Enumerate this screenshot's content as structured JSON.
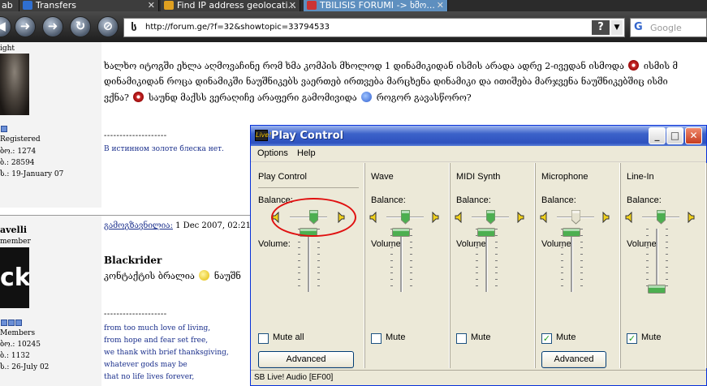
{
  "browser": {
    "tabs": [
      {
        "label": "ab",
        "active": false
      },
      {
        "label": "Transfers",
        "active": false
      },
      {
        "label": "Find IP address geolocati...",
        "active": false
      },
      {
        "label": "TBILISIS FORUMI -> ხმო...",
        "active": true
      }
    ],
    "url": "http://forum.ge/?f=32&showtopic=33794533",
    "help_glyph": "?",
    "search_placeholder": "Google",
    "search_logo": "G",
    "close_glyph": "✕",
    "site_favicon": "ს"
  },
  "forum": {
    "user1": {
      "name_partial": "ight",
      "group": "Registered",
      "posts_label": "ბო.: 1274",
      "id_label": "ბ.: 28594",
      "joined": "ს.: 19-January 07"
    },
    "user2": {
      "name_partial": "avelli",
      "rank": "member",
      "avatar_text": "ck",
      "group": "Members",
      "posts_label": "ბო.: 10245",
      "id_label": "ბ.: 1132",
      "joined": "ს.: 26-July 02"
    },
    "post1": {
      "line1": "ხალხო იტოგში ეხლა აღმოვაჩინე რომ ხმა კომპის მხოლოდ 1 დინამიკიდან ისმის არადა ადრე 2-ივედან ისმოდა",
      "line1_tail": "ისმის მ",
      "line2": "დინამიკიდან როცა დინამიკში ნაუშნიკებს ვაერთებ ირთვება მარცხენა დინამიკი და ითიშება მარჯვენა ნაუშნიკებშიც ისმი",
      "line3_a": "ვქნა?",
      "line3_b": "საუნდ მაქსს ვერაღიჩე არაფერი გამომივიდა",
      "line3_c": "როგორ გავასწორო?",
      "dashes": "--------------------",
      "signature": "В истинном золоте блеска нет."
    },
    "post2": {
      "author_link": "გამოგზავნილია:",
      "date": "1 Dec 2007, 02:21",
      "author": "Blackrider",
      "text": "კონტაქტის ბრალია",
      "text_tail": "ნაუშნ",
      "dashes": "--------------------",
      "sig_lines": [
        "from too much love of living,",
        "from hope and fear set free,",
        "we thank with brief thanksgiving,",
        "whatever gods may be",
        "that no life lives forever,"
      ]
    }
  },
  "play_control": {
    "title": "Play Control",
    "icon_text": "Live!",
    "menu": [
      "Options",
      "Help"
    ],
    "balance_label": "Balance:",
    "volume_label": "Volume:",
    "status": "SB Live! Audio [EF00]",
    "minimize_glyph": "_",
    "maximize_glyph": "□",
    "close_glyph": "✕",
    "channels": [
      {
        "name": "Play Control",
        "mute_label": "Mute all",
        "muted": false,
        "has_advanced": true,
        "advanced_label": "Advanced",
        "balance": 0.62,
        "volume": 1.0,
        "disabled_balance": false
      },
      {
        "name": "Wave",
        "mute_label": "Mute",
        "muted": false,
        "has_advanced": false,
        "balance": 0.5,
        "volume": 1.0,
        "disabled_balance": false
      },
      {
        "name": "MIDI Synth",
        "mute_label": "Mute",
        "muted": false,
        "has_advanced": false,
        "balance": 0.5,
        "volume": 1.0,
        "disabled_balance": false
      },
      {
        "name": "Microphone",
        "mute_label": "Mute",
        "muted": true,
        "has_advanced": true,
        "advanced_label": "Advanced",
        "balance": 0.5,
        "volume": 1.0,
        "disabled_balance": true
      },
      {
        "name": "Line-In",
        "mute_label": "Mute",
        "muted": true,
        "has_advanced": false,
        "balance": 0.5,
        "volume": 0.0,
        "disabled_balance": false
      }
    ],
    "check_glyph": "✓"
  },
  "colors": {
    "accent_title": "#2e52bf",
    "highlight_circle": "#e01010",
    "thumb_green": "#4caf50"
  }
}
